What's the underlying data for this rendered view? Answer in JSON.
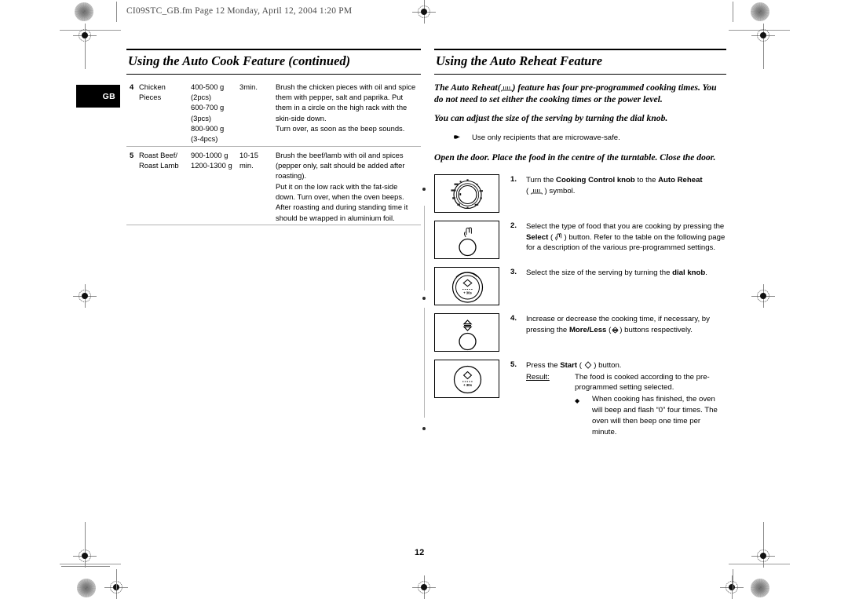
{
  "document": {
    "running_head": "CI09STC_GB.fm  Page 12  Monday, April 12, 2004  1:20 PM",
    "page_number": "12",
    "language_tab": "GB"
  },
  "left_column": {
    "title": "Using the Auto Cook Feature (continued)",
    "table": {
      "rows": [
        {
          "no": "4",
          "food": "Chicken\nPieces",
          "weight": "400-500 g\n(2pcs)\n600-700 g\n(3pcs)\n800-900 g\n(3-4pcs)",
          "time": "3min.",
          "description": "Brush the chicken pieces with oil and spice them with pepper, salt and paprika. Put them in a circle on the high rack with the skin-side down.\nTurn over, as soon as the beep sounds."
        },
        {
          "no": "5",
          "food": "Roast Beef/\nRoast Lamb",
          "weight": "900-1000 g\n1200-1300 g",
          "time": "10-15\nmin.",
          "description": "Brush the beef/lamb with oil and spices (pepper only, salt should be added after roasting).\nPut it on the low rack with the fat-side down. Turn over, when the oven beeps. After roasting and during standing time it should be wrapped in aluminium foil."
        }
      ]
    }
  },
  "right_column": {
    "title": "Using the Auto Reheat Feature",
    "lead_1_before": "The Auto Reheat(",
    "lead_1_after": ") feature has four pre-programmed cooking times. You do not need to set either the cooking times or the power level.",
    "lead_2": "You can adjust the size of the serving by turning the dial knob.",
    "note": {
      "icon": "pointing-hand-icon",
      "text": "Use only recipients that are microwave-safe."
    },
    "lead_3": "Open the door. Place the food in the centre of the turntable. Close the door.",
    "steps": [
      {
        "number": "1.",
        "panel": "cooking-control-knob-dial",
        "parts": [
          {
            "t": "Turn the "
          },
          {
            "t": "Cooking Control knob",
            "bold": true
          },
          {
            "t": " to the "
          },
          {
            "t": "Auto Reheat",
            "bold": true
          },
          {
            "t": " ("
          },
          {
            "t": "auto-reheat-icon",
            "icon": "reheat"
          },
          {
            "t": ") symbol."
          }
        ]
      },
      {
        "number": "2.",
        "panel": "select-button",
        "parts": [
          {
            "t": "Select the type of food that you are cooking by pressing the "
          },
          {
            "t": "Select",
            "bold": true
          },
          {
            "t": " ("
          },
          {
            "t": "select-icon",
            "icon": "select"
          },
          {
            "t": ") button. Refer to the table on the following page for a description of the various pre-programmed settings."
          }
        ]
      },
      {
        "number": "3.",
        "panel": "dial-knob",
        "parts": [
          {
            "t": "Select the size of the serving by turning the "
          },
          {
            "t": "dial knob",
            "bold": true
          },
          {
            "t": "."
          }
        ]
      },
      {
        "number": "4.",
        "panel": "more-less-button",
        "parts": [
          {
            "t": "Increase or decrease the cooking time, if necessary, by pressing the "
          },
          {
            "t": "More/Less",
            "bold": true
          },
          {
            "t": " ("
          },
          {
            "t": "more-less-icon",
            "icon": "moreless"
          },
          {
            "t": ") buttons respectively."
          }
        ]
      },
      {
        "number": "5.",
        "panel": "start-button",
        "parts": [
          {
            "t": "Press the "
          },
          {
            "t": "Start",
            "bold": true
          },
          {
            "t": " ("
          },
          {
            "t": "start-icon",
            "icon": "start"
          },
          {
            "t": ") button."
          }
        ],
        "result_label": "Result:",
        "result_text": "The food is cooked according to the pre-programmed setting selected.",
        "result_bullet": "When cooking has finished, the oven will beep and flash “0” four times. The oven will then beep one time per minute."
      }
    ]
  },
  "colors": {
    "ink": "#000000",
    "rule": "#b3b3b3",
    "tab_bg": "#000000",
    "tab_fg": "#ffffff",
    "marks": "#8a8a8a"
  }
}
